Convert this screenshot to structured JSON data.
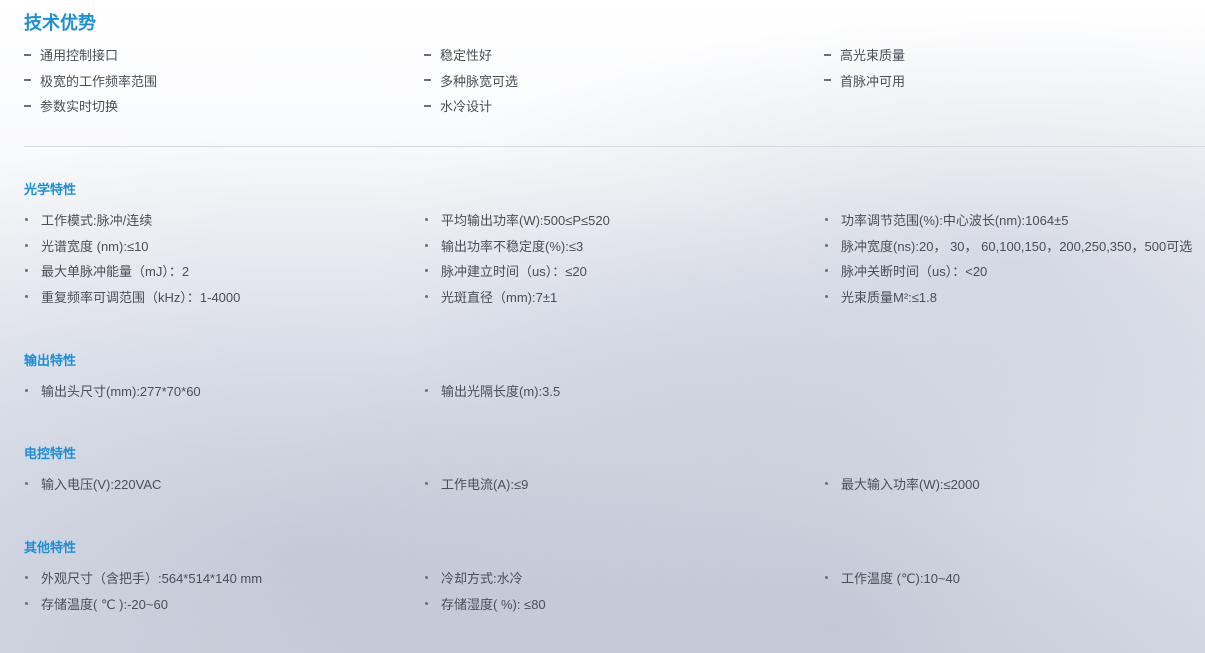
{
  "title": "技术优势",
  "advantages": [
    "通用控制接口",
    "稳定性好",
    "高光束质量",
    "极宽的工作频率范围",
    "多种脉宽可选",
    "首脉冲可用",
    "参数实时切换",
    "水冷设计"
  ],
  "sections": [
    {
      "title": "光学特性",
      "items": [
        "工作模式:脉冲/连续",
        "平均输出功率(W):500≤P≤520",
        "功率调节范围(%):中心波长(nm):1064±5",
        "光谱宽度 (nm):≤10",
        "输出功率不稳定度(%):≤3",
        "脉冲宽度(ns):20， 30， 60,100,150，200,250,350，500可选",
        "最大单脉冲能量（mJ）：2",
        "脉冲建立时间（us）：≤20",
        "脉冲关断时间（us）：<20",
        "重复频率可调范围（kHz）：1-4000",
        "光斑直径（mm):7±1",
        "光束质量M²:≤1.8"
      ]
    },
    {
      "title": "输出特性",
      "items": [
        "输出头尺寸(mm):277*70*60",
        "输出光隔长度(m):3.5"
      ]
    },
    {
      "title": "电控特性",
      "items": [
        "输入电压(V):220VAC",
        "工作电流(A):≤9",
        "最大输入功率(W):≤2000"
      ]
    },
    {
      "title": "其他特性",
      "items": [
        "外观尺寸（含把手）:564*514*140 mm",
        "冷却方式:水冷",
        "工作温度 (℃):10~40",
        "存储温度( ℃ ):-20~60",
        "存储湿度( %): ≤80"
      ]
    }
  ]
}
